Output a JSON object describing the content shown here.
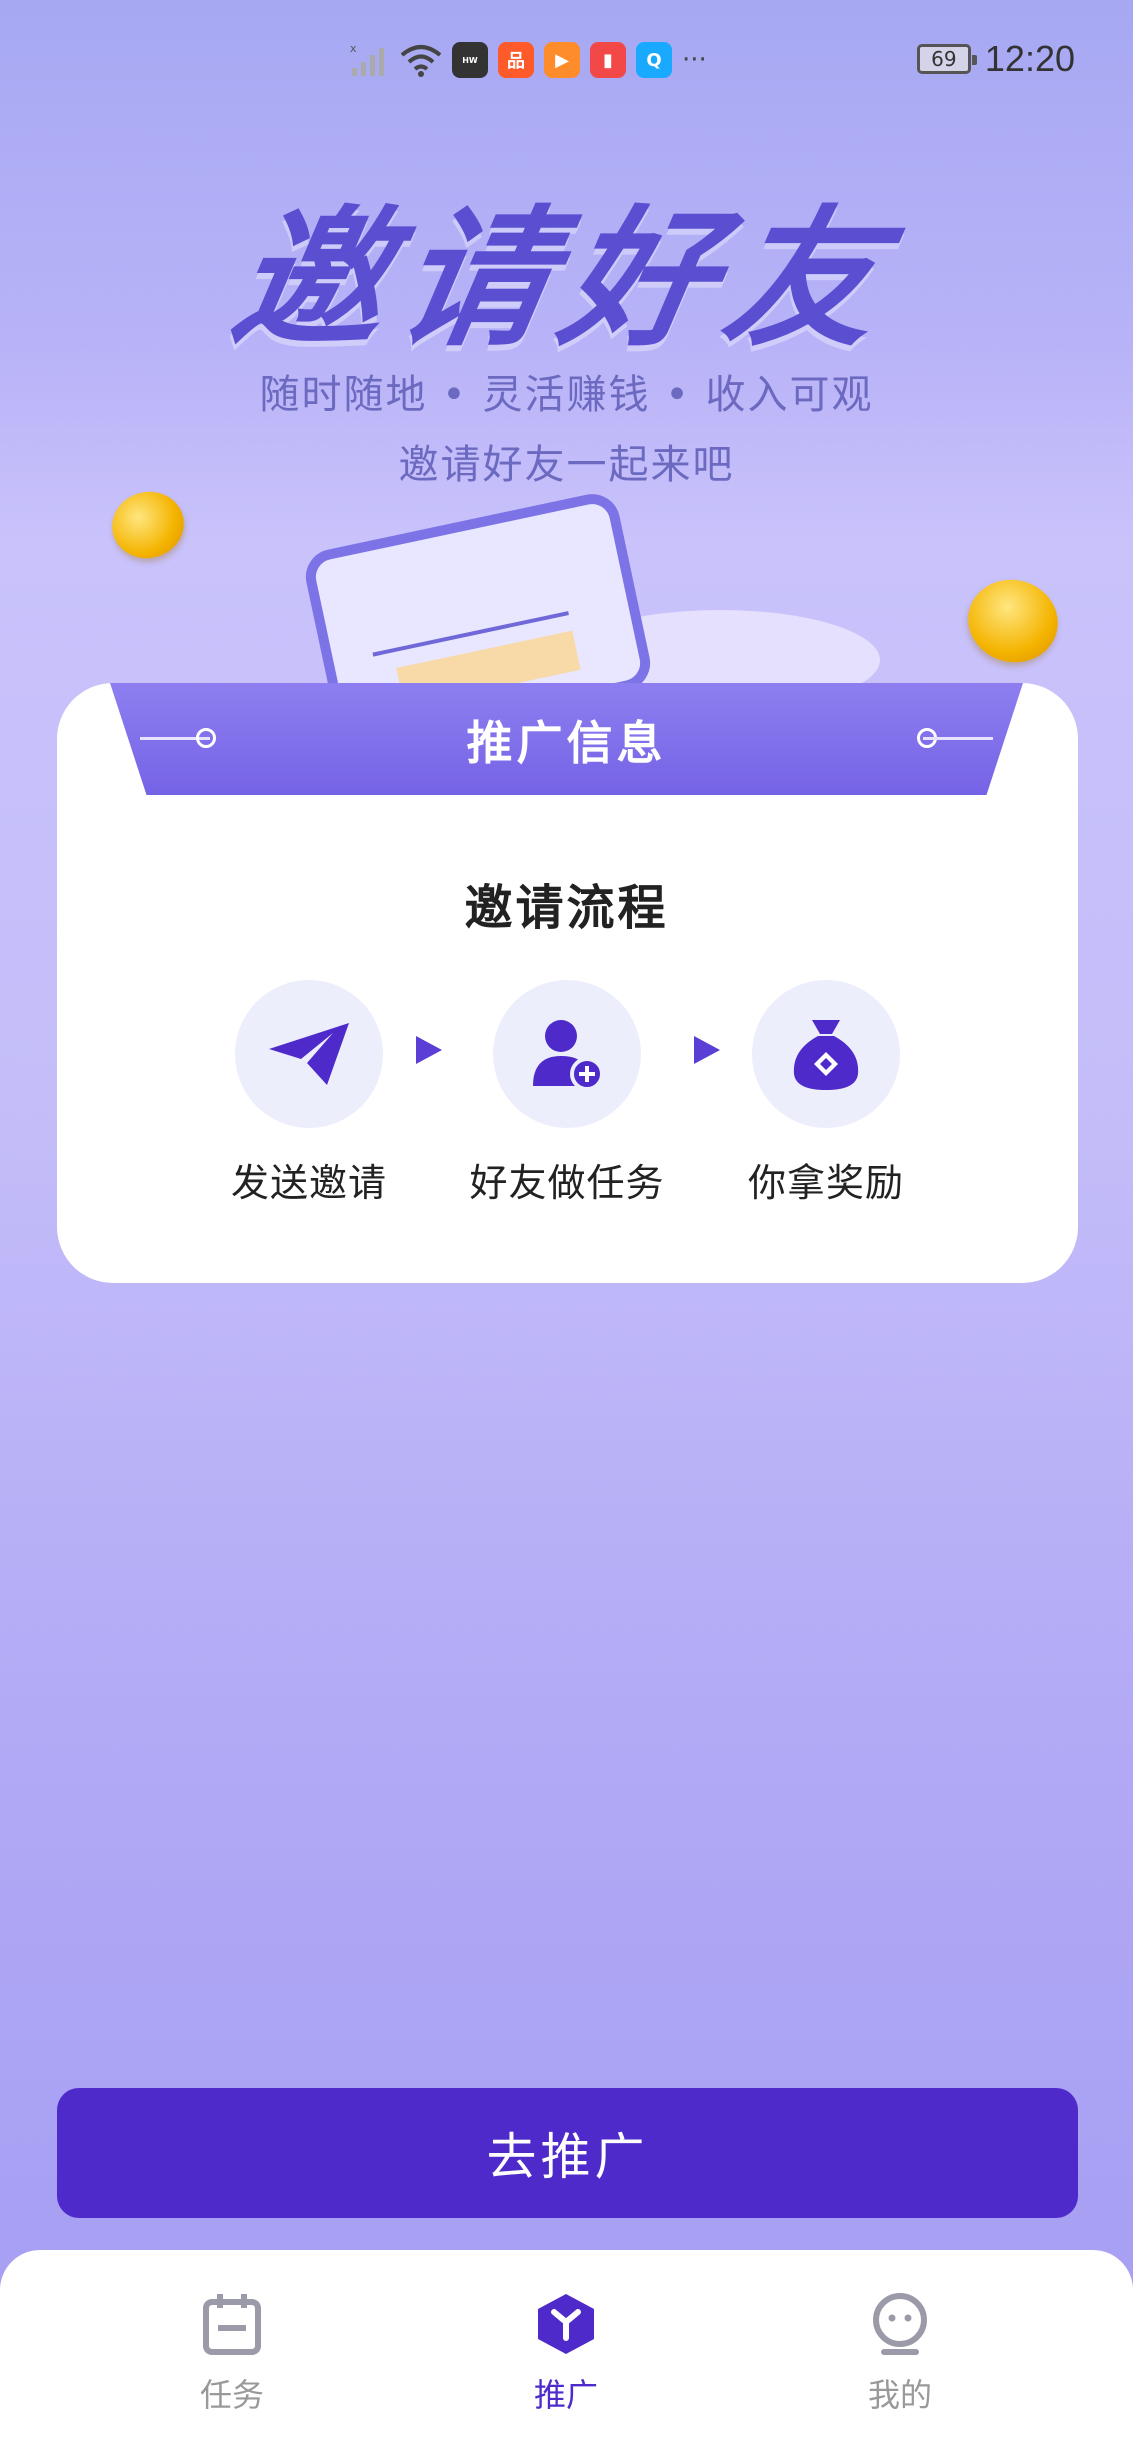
{
  "status_bar": {
    "time": "12:20",
    "battery": "69",
    "more_icon": "···"
  },
  "hero": {
    "title": "邀请好友",
    "subtitle": "随时随地 • 灵活赚钱 • 收入可观",
    "subtitle2": "邀请好友一起来吧"
  },
  "card": {
    "header_title": "推广信息",
    "flow_title": "邀请流程",
    "steps": [
      {
        "label": "发送邀请",
        "icon": "paper-plane-icon"
      },
      {
        "label": "好友做任务",
        "icon": "add-user-icon"
      },
      {
        "label": "你拿奖励",
        "icon": "money-bag-icon"
      }
    ]
  },
  "cta": {
    "label": "去推广"
  },
  "tabs": [
    {
      "label": "任务",
      "icon": "calendar-icon",
      "active": false
    },
    {
      "label": "推广",
      "icon": "cube-icon",
      "active": true
    },
    {
      "label": "我的",
      "icon": "profile-icon",
      "active": false
    }
  ],
  "colors": {
    "primary": "#4f2acb",
    "accent": "#5a4fd1",
    "inactive": "#999999"
  }
}
